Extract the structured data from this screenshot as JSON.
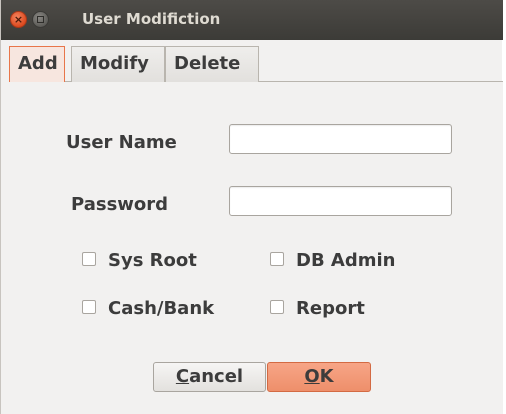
{
  "window": {
    "title": "User Modifiction"
  },
  "tabs": [
    {
      "label": "Add",
      "active": true
    },
    {
      "label": "Modify",
      "active": false
    },
    {
      "label": "Delete",
      "active": false
    }
  ],
  "form": {
    "username_label": "User Name",
    "username_value": "",
    "password_label": "Password",
    "password_value": "",
    "checkboxes": [
      {
        "label": "Sys Root",
        "checked": false
      },
      {
        "label": "DB Admin",
        "checked": false
      },
      {
        "label": "Cash/Bank",
        "checked": false
      },
      {
        "label": "Report",
        "checked": false
      }
    ]
  },
  "buttons": {
    "cancel_mnemonic": "C",
    "cancel_rest": "ancel",
    "ok_mnemonic": "O",
    "ok_rest": "K"
  },
  "colors": {
    "titlebar": "#3c3b37",
    "active_tab_border": "#e8764a",
    "ok_button": "#ee8f6b",
    "close_button": "#dc4a1f"
  },
  "icons": {
    "close": "close-icon",
    "minimize": "minimize-icon"
  }
}
